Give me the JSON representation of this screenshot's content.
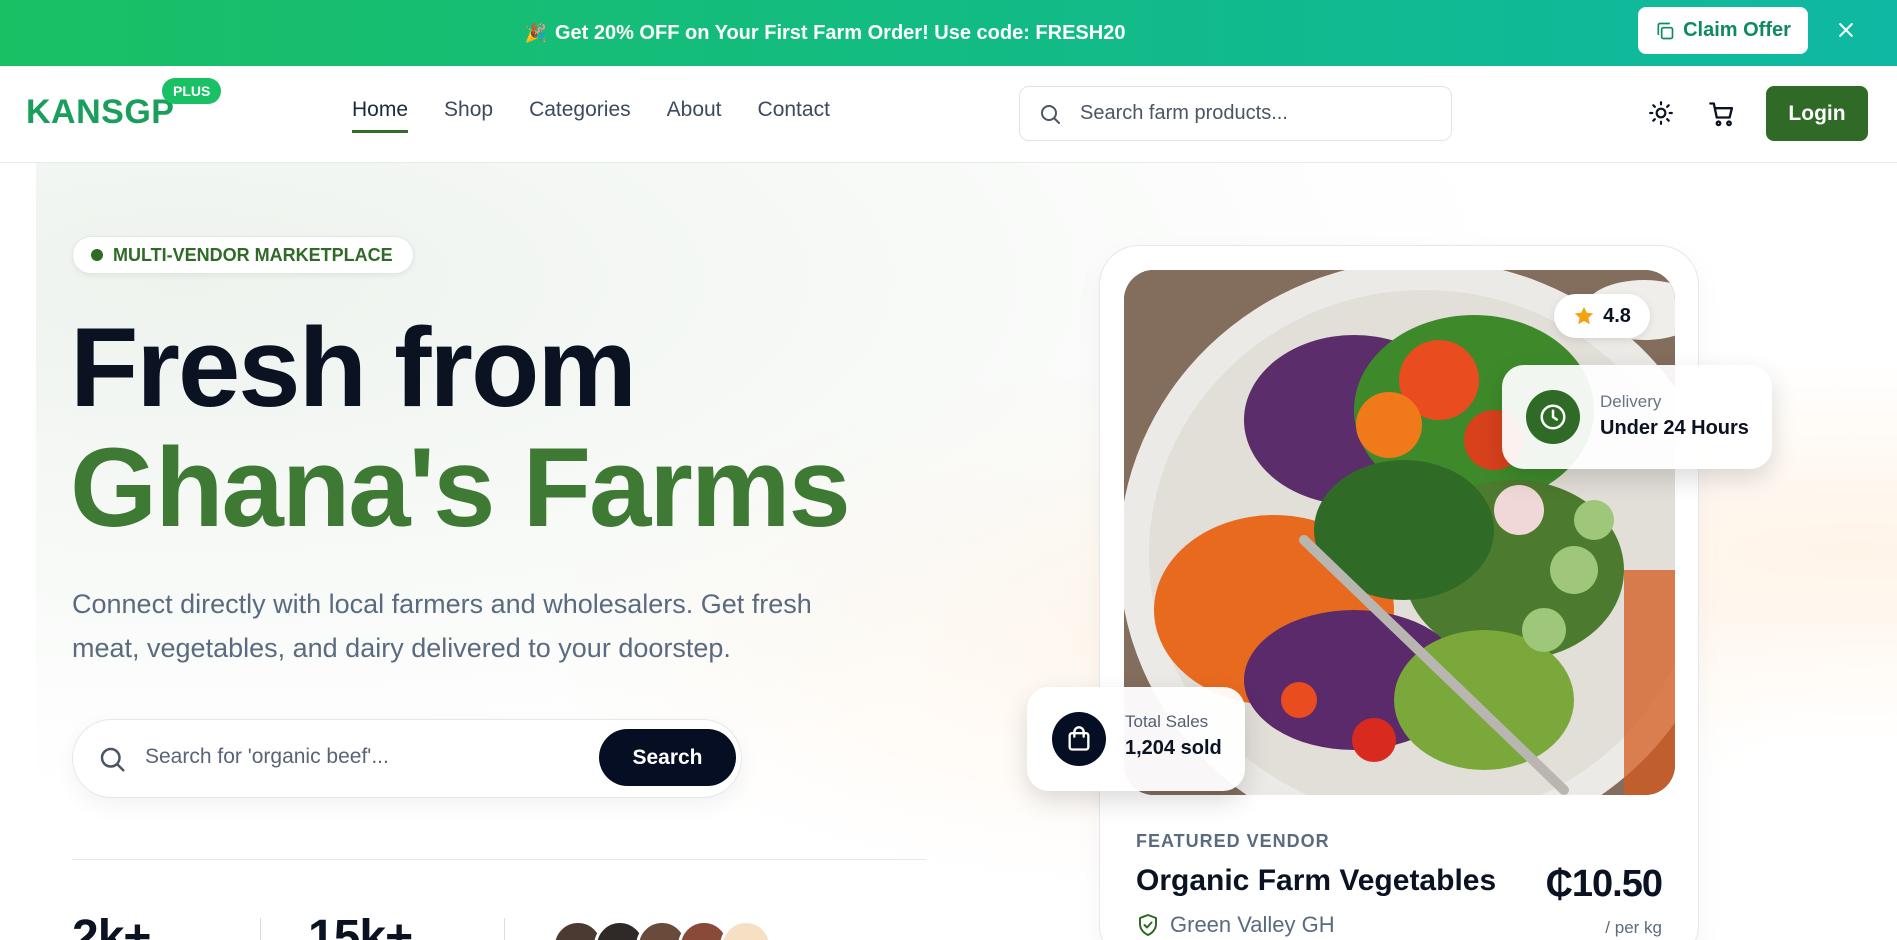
{
  "promo": {
    "emoji": "🎉",
    "text": "Get 20% OFF on Your First Farm Order! Use code: FRESH20",
    "claim_label": "Claim Offer"
  },
  "nav": {
    "logo": "KANSGP",
    "logo_badge": "PLUS",
    "links": [
      "Home",
      "Shop",
      "Categories",
      "About",
      "Contact"
    ],
    "active_link": "Home",
    "search_placeholder": "Search farm products...",
    "login_label": "Login"
  },
  "hero": {
    "tag": "MULTI-VENDOR MARKETPLACE",
    "title_line1": "Fresh from",
    "title_line2": "Ghana's Farms",
    "subtitle": "Connect directly with local farmers and wholesalers. Get fresh meat, vegetables, and dairy delivered to your doorstep.",
    "search_placeholder": "Search for 'organic beef'...",
    "search_button": "Search",
    "stats": [
      "2k+",
      "15k+"
    ]
  },
  "featured": {
    "rating": "4.8",
    "delivery_label": "Delivery",
    "delivery_value": "Under 24 Hours",
    "sales_label": "Total Sales",
    "sales_value": "1,204 sold",
    "label": "FEATURED VENDOR",
    "title": "Organic Farm Vegetables",
    "price": "₵10.50",
    "unit": "/ per kg",
    "vendor": "Green Valley GH"
  },
  "colors": {
    "brand_green": "#2f6a26",
    "accent_green": "#19c064",
    "dark": "#050e22"
  }
}
